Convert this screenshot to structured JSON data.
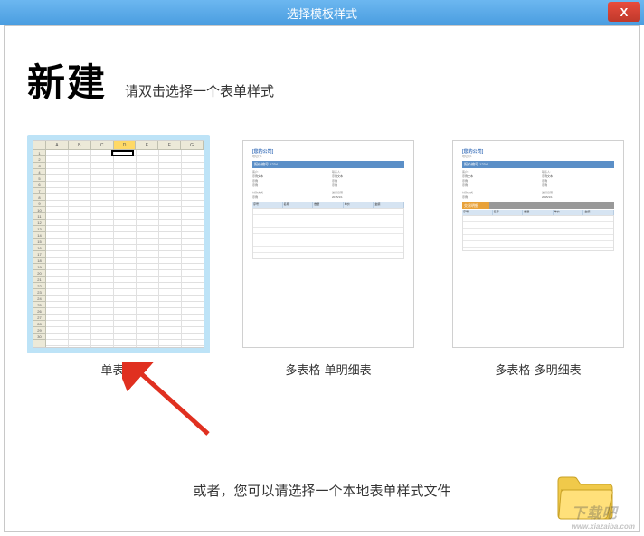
{
  "titlebar": {
    "title": "选择模板样式",
    "close_label": "X"
  },
  "header": {
    "heading": "新建",
    "subtitle": "请双击选择一个表单样式"
  },
  "templates": [
    {
      "label": "单表格",
      "selected": true
    },
    {
      "label": "多表格-单明细表",
      "selected": false
    },
    {
      "label": "多表格-多明细表",
      "selected": false
    }
  ],
  "thumb_form": {
    "company": "[您的公司]",
    "title_bar": "报价编号 1234",
    "detail_bar": "交易明细"
  },
  "bottom": {
    "alt_text": "或者，您可以请选择一个本地表单样式文件"
  },
  "watermark": {
    "main": "下载吧",
    "sub": "www.xiazaiba.com"
  }
}
